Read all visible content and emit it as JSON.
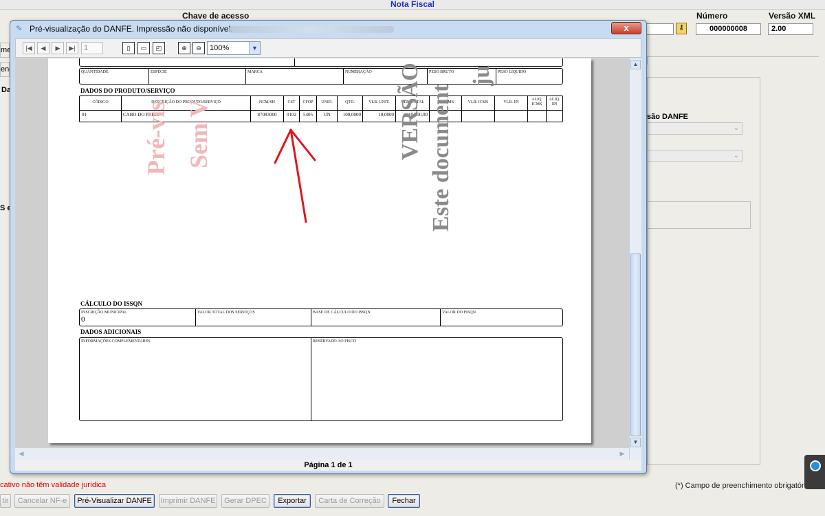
{
  "background": {
    "title": "Nota Fiscal",
    "chave_label": "Chave de acesso",
    "numero_label": "Número",
    "numero_value": "000000008",
    "versao_label": "Versão XML",
    "versao_value": "2.00",
    "side_labels": [
      "met",
      "eno",
      "Da",
      "S e"
    ],
    "danfe_label": "são DANFE",
    "warning": "cativo não têm validade jurídica",
    "required_note": "(*) Campo de preenchimento obrigatório.",
    "buttons": [
      "tir",
      "Cancelar NF-e",
      "Pré-Visualizar DANFE",
      "Imprimir DANFE",
      "Gerar DPEC",
      "Exportar",
      "Carta de Correção",
      "Fechar"
    ]
  },
  "window": {
    "title": "Pré-visualização do DANFE. Impressão não disponível.",
    "close": "x",
    "page_number": "1",
    "zoom": "100%",
    "status": "Página 1 de 1"
  },
  "danfe": {
    "volumes_headers": [
      "QUANTIDADE",
      "ESPÉCIE",
      "MARCA",
      "NUMERAÇÃO",
      "PESO BRUTO",
      "PESO LÍQUIDO"
    ],
    "products_title": "DADOS DO PRODUTO/SERVIÇO",
    "product_headers": [
      "CÓDIGO",
      "DESCRIÇÃO DO PRODUTO/SERVIÇO",
      "NCM/SH",
      "CST",
      "CFOP",
      "UNID.",
      "QTD.",
      "VLR. UNIT.",
      "VLR. TOTAL",
      "BC ICMS",
      "VLR. ICMS",
      "VLR. IPI",
      "ALIQ. ICMS",
      "ALIQ. IPI"
    ],
    "product_row": [
      "01",
      "CABO DO FREIO",
      "87083000",
      "0102",
      "5405",
      "UN",
      "100,0000",
      "10,0000",
      "10.000,00"
    ],
    "issqn_title": "CÁLCULO DO ISSQN",
    "issqn_headers": [
      "INSCRIÇÃO MUNICIPAL",
      "VALOR TOTAL DOS SERVIÇOS",
      "BASE DE CÁLCULO DO ISSQN",
      "VALOR DO ISSQN"
    ],
    "issqn_value": "0",
    "adicionais_title": "DADOS ADICIONAIS",
    "info_label": "INFORMAÇÕES COMPLEMENTARES",
    "fisco_label": "RESERVADO AO FISCO",
    "watermark_red_1": "Pré-vis",
    "watermark_red_2": "Sem V",
    "watermark_gray_1": "VERSÃO",
    "watermark_gray_2": "Este document",
    "watermark_gray_3": "ju"
  },
  "colors": {
    "title_blue": "#1f2fd6",
    "warning_red": "#e00000",
    "arrow_red": "#e0161c",
    "watermark_red": "#f2b8b8",
    "watermark_gray": "#8a8a8a"
  }
}
